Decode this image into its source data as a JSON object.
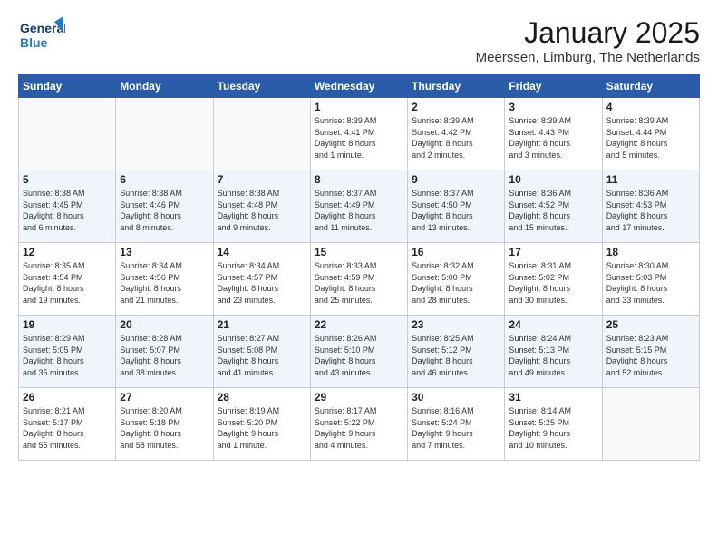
{
  "logo": {
    "line1": "General",
    "line2": "Blue"
  },
  "title": "January 2025",
  "location": "Meerssen, Limburg, The Netherlands",
  "weekdays": [
    "Sunday",
    "Monday",
    "Tuesday",
    "Wednesday",
    "Thursday",
    "Friday",
    "Saturday"
  ],
  "weeks": [
    [
      {
        "day": "",
        "detail": ""
      },
      {
        "day": "",
        "detail": ""
      },
      {
        "day": "",
        "detail": ""
      },
      {
        "day": "1",
        "detail": "Sunrise: 8:39 AM\nSunset: 4:41 PM\nDaylight: 8 hours\nand 1 minute."
      },
      {
        "day": "2",
        "detail": "Sunrise: 8:39 AM\nSunset: 4:42 PM\nDaylight: 8 hours\nand 2 minutes."
      },
      {
        "day": "3",
        "detail": "Sunrise: 8:39 AM\nSunset: 4:43 PM\nDaylight: 8 hours\nand 3 minutes."
      },
      {
        "day": "4",
        "detail": "Sunrise: 8:39 AM\nSunset: 4:44 PM\nDaylight: 8 hours\nand 5 minutes."
      }
    ],
    [
      {
        "day": "5",
        "detail": "Sunrise: 8:38 AM\nSunset: 4:45 PM\nDaylight: 8 hours\nand 6 minutes."
      },
      {
        "day": "6",
        "detail": "Sunrise: 8:38 AM\nSunset: 4:46 PM\nDaylight: 8 hours\nand 8 minutes."
      },
      {
        "day": "7",
        "detail": "Sunrise: 8:38 AM\nSunset: 4:48 PM\nDaylight: 8 hours\nand 9 minutes."
      },
      {
        "day": "8",
        "detail": "Sunrise: 8:37 AM\nSunset: 4:49 PM\nDaylight: 8 hours\nand 11 minutes."
      },
      {
        "day": "9",
        "detail": "Sunrise: 8:37 AM\nSunset: 4:50 PM\nDaylight: 8 hours\nand 13 minutes."
      },
      {
        "day": "10",
        "detail": "Sunrise: 8:36 AM\nSunset: 4:52 PM\nDaylight: 8 hours\nand 15 minutes."
      },
      {
        "day": "11",
        "detail": "Sunrise: 8:36 AM\nSunset: 4:53 PM\nDaylight: 8 hours\nand 17 minutes."
      }
    ],
    [
      {
        "day": "12",
        "detail": "Sunrise: 8:35 AM\nSunset: 4:54 PM\nDaylight: 8 hours\nand 19 minutes."
      },
      {
        "day": "13",
        "detail": "Sunrise: 8:34 AM\nSunset: 4:56 PM\nDaylight: 8 hours\nand 21 minutes."
      },
      {
        "day": "14",
        "detail": "Sunrise: 8:34 AM\nSunset: 4:57 PM\nDaylight: 8 hours\nand 23 minutes."
      },
      {
        "day": "15",
        "detail": "Sunrise: 8:33 AM\nSunset: 4:59 PM\nDaylight: 8 hours\nand 25 minutes."
      },
      {
        "day": "16",
        "detail": "Sunrise: 8:32 AM\nSunset: 5:00 PM\nDaylight: 8 hours\nand 28 minutes."
      },
      {
        "day": "17",
        "detail": "Sunrise: 8:31 AM\nSunset: 5:02 PM\nDaylight: 8 hours\nand 30 minutes."
      },
      {
        "day": "18",
        "detail": "Sunrise: 8:30 AM\nSunset: 5:03 PM\nDaylight: 8 hours\nand 33 minutes."
      }
    ],
    [
      {
        "day": "19",
        "detail": "Sunrise: 8:29 AM\nSunset: 5:05 PM\nDaylight: 8 hours\nand 35 minutes."
      },
      {
        "day": "20",
        "detail": "Sunrise: 8:28 AM\nSunset: 5:07 PM\nDaylight: 8 hours\nand 38 minutes."
      },
      {
        "day": "21",
        "detail": "Sunrise: 8:27 AM\nSunset: 5:08 PM\nDaylight: 8 hours\nand 41 minutes."
      },
      {
        "day": "22",
        "detail": "Sunrise: 8:26 AM\nSunset: 5:10 PM\nDaylight: 8 hours\nand 43 minutes."
      },
      {
        "day": "23",
        "detail": "Sunrise: 8:25 AM\nSunset: 5:12 PM\nDaylight: 8 hours\nand 46 minutes."
      },
      {
        "day": "24",
        "detail": "Sunrise: 8:24 AM\nSunset: 5:13 PM\nDaylight: 8 hours\nand 49 minutes."
      },
      {
        "day": "25",
        "detail": "Sunrise: 8:23 AM\nSunset: 5:15 PM\nDaylight: 8 hours\nand 52 minutes."
      }
    ],
    [
      {
        "day": "26",
        "detail": "Sunrise: 8:21 AM\nSunset: 5:17 PM\nDaylight: 8 hours\nand 55 minutes."
      },
      {
        "day": "27",
        "detail": "Sunrise: 8:20 AM\nSunset: 5:18 PM\nDaylight: 8 hours\nand 58 minutes."
      },
      {
        "day": "28",
        "detail": "Sunrise: 8:19 AM\nSunset: 5:20 PM\nDaylight: 9 hours\nand 1 minute."
      },
      {
        "day": "29",
        "detail": "Sunrise: 8:17 AM\nSunset: 5:22 PM\nDaylight: 9 hours\nand 4 minutes."
      },
      {
        "day": "30",
        "detail": "Sunrise: 8:16 AM\nSunset: 5:24 PM\nDaylight: 9 hours\nand 7 minutes."
      },
      {
        "day": "31",
        "detail": "Sunrise: 8:14 AM\nSunset: 5:25 PM\nDaylight: 9 hours\nand 10 minutes."
      },
      {
        "day": "",
        "detail": ""
      }
    ]
  ]
}
